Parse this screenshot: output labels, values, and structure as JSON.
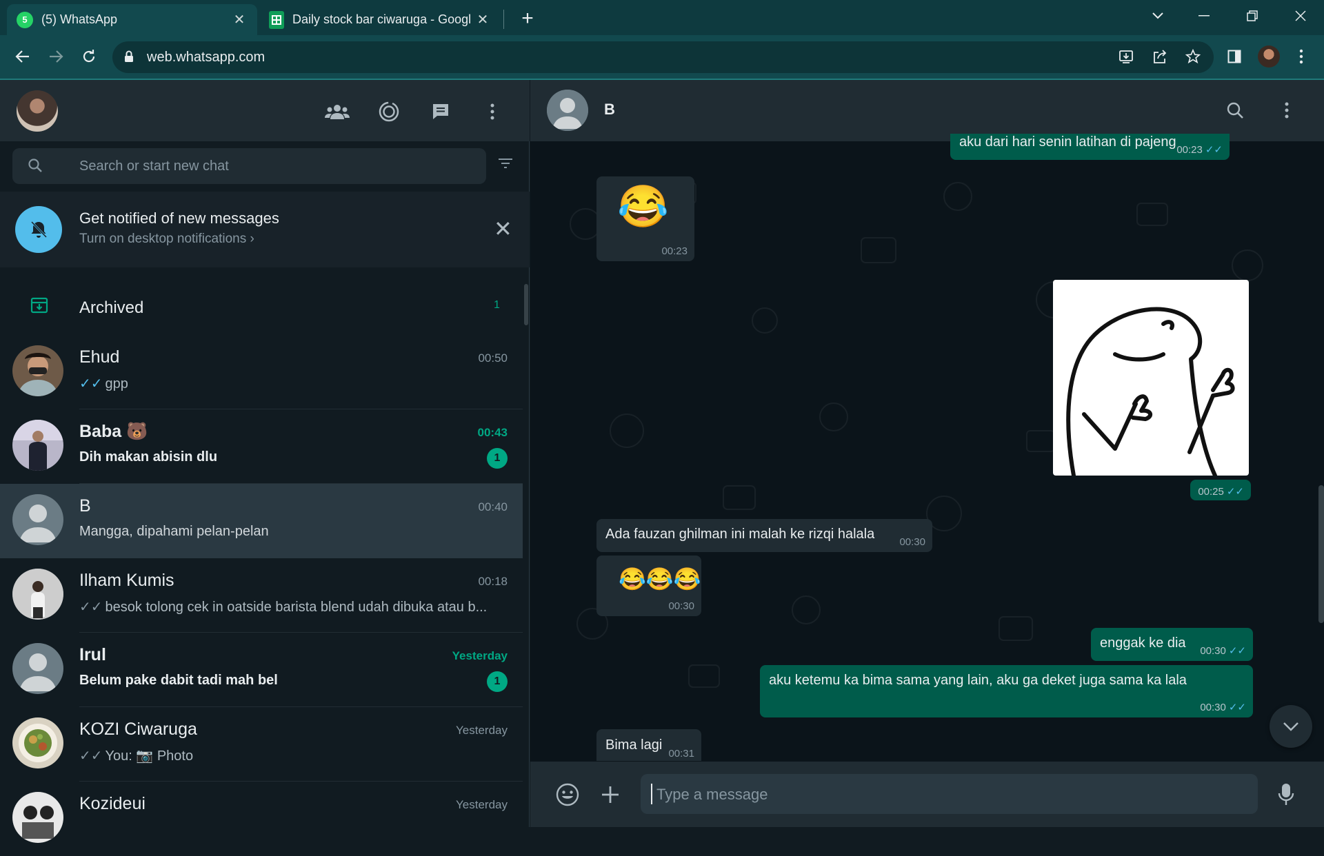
{
  "browser": {
    "tabs": [
      {
        "title": "(5) WhatsApp",
        "favicon_badge": "5",
        "active": true
      },
      {
        "title": "Daily stock bar ciwaruga - Googl",
        "active": false
      }
    ],
    "url": "web.whatsapp.com",
    "new_tab": "+"
  },
  "sidebar": {
    "search_placeholder": "Search or start new chat",
    "notify_title": "Get notified of new messages",
    "notify_sub": "Turn on desktop notifications ›",
    "archived_label": "Archived",
    "archived_count": "1",
    "chats": [
      {
        "name": "Ehud",
        "time": "00:50",
        "preview": "gpp",
        "tick": "blue",
        "unread": "",
        "bold": false
      },
      {
        "name": "Baba 🐻",
        "time": "00:43",
        "preview": "Dih makan abisin dlu",
        "tick": "",
        "unread": "1",
        "bold": true
      },
      {
        "name": "B",
        "time": "00:40",
        "preview": "Mangga, dipahami pelan-pelan",
        "tick": "",
        "unread": "",
        "bold": false,
        "selected": true
      },
      {
        "name": "Ilham Kumis",
        "time": "00:18",
        "preview": "besok tolong cek in oatside barista blend udah dibuka atau b...",
        "tick": "grey",
        "unread": "",
        "bold": false
      },
      {
        "name": "Irul",
        "time": "Yesterday",
        "preview": "Belum pake dabit tadi mah bel",
        "tick": "",
        "unread": "1",
        "bold": true
      },
      {
        "name": "KOZI Ciwaruga",
        "time": "Yesterday",
        "preview": "You: 📷 Photo",
        "tick": "grey",
        "unread": "",
        "bold": false
      },
      {
        "name": "Kozideui",
        "time": "Yesterday",
        "preview": "",
        "tick": "",
        "unread": "",
        "bold": false
      }
    ]
  },
  "conversation": {
    "contact_name": "B",
    "messages": [
      {
        "dir": "out",
        "text": "aku dari hari senin latihan di pajeng",
        "time": "00:23"
      },
      {
        "dir": "in",
        "text": "😂",
        "time": "00:23"
      },
      {
        "dir": "out",
        "text": "",
        "time": "00:25",
        "kind": "sticker"
      },
      {
        "dir": "in",
        "text": "Ada fauzan ghilman ini malah ke rizqi halala",
        "time": "00:30"
      },
      {
        "dir": "in",
        "text": "😂😂😂",
        "time": "00:30"
      },
      {
        "dir": "out",
        "text": "enggak ke dia",
        "time": "00:30"
      },
      {
        "dir": "out",
        "text": "aku ketemu ka bima sama yang lain, aku ga deket juga sama ka lala",
        "time": "00:30"
      },
      {
        "dir": "in",
        "text": "Bima lagi",
        "time": "00:31"
      }
    ],
    "input_placeholder": "Type a message"
  },
  "colors": {
    "accent": "#00a884",
    "outgoing": "#005c4b",
    "incoming": "#202c33",
    "read_tick": "#53bdeb"
  }
}
